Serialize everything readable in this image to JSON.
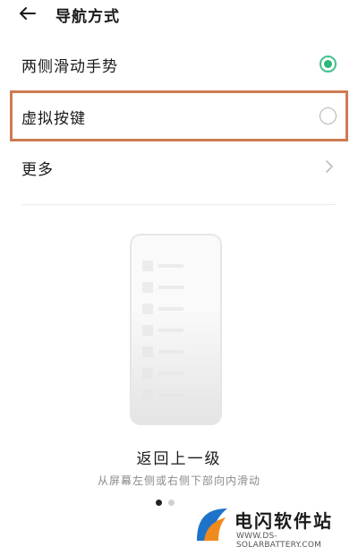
{
  "header": {
    "back_icon": "back-arrow-icon",
    "title": "导航方式"
  },
  "options": [
    {
      "label": "两侧滑动手势",
      "state": "selected",
      "control_icon": "radio-checked-icon",
      "accent": "#2fb57a"
    },
    {
      "label": "虚拟按键",
      "state": "unselected",
      "control_icon": "radio-unchecked-icon",
      "highlight_color": "#cf7a52"
    },
    {
      "label": "更多",
      "control_icon": "chevron-right-icon"
    }
  ],
  "preview": {
    "title": "返回上一级",
    "subtitle": "从屏幕左侧或右侧下部向内滑动",
    "page_indicator": {
      "total": 2,
      "active": 1
    }
  },
  "watermark": {
    "title": "电闪软件站",
    "url": "WWW.DS-SOLARBATTERY.COM"
  }
}
